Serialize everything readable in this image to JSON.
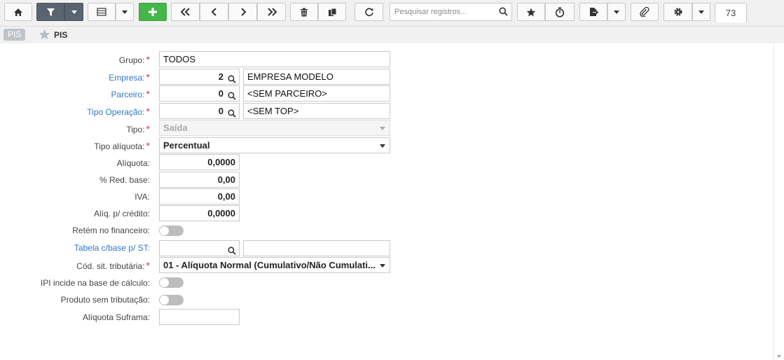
{
  "toolbar": {
    "buttons": [
      "home-icon",
      "filter-icon",
      "dropdown-caret-icon",
      "grid-icon",
      "dropdown-caret-icon",
      "plus-icon",
      "first-icon",
      "previous-icon",
      "next-icon",
      "last-icon",
      "trash-icon",
      "copy-icon",
      "refresh-icon",
      "star-icon",
      "timer-icon",
      "export-icon",
      "dropdown-caret-icon",
      "paperclip-icon",
      "gear-icon",
      "dropdown-caret-icon"
    ],
    "search_placeholder": "Pesquisar registros...",
    "record_count": "73"
  },
  "breadcrumb": {
    "tag": "PIS",
    "title": "PIS"
  },
  "form": {
    "grupo": {
      "label": "Grupo:",
      "value": "TODOS"
    },
    "empresa": {
      "label": "Empresa:",
      "code": "2",
      "name": "EMPRESA MODELO"
    },
    "parceiro": {
      "label": "Parceiro:",
      "code": "0",
      "name": "<SEM PARCEIRO>"
    },
    "tipo_operacao": {
      "label": "Tipo Operação:",
      "code": "0",
      "name": "<SEM TOP>"
    },
    "tipo": {
      "label": "Tipo:",
      "value": "Saída"
    },
    "tipo_aliquota": {
      "label": "Tipo alíquota:",
      "value": "Percentual"
    },
    "aliquota": {
      "label": "Alíquota:",
      "value": "0,0000"
    },
    "red_base": {
      "label": "% Red. base:",
      "value": "0,00"
    },
    "iva": {
      "label": "IVA:",
      "value": "0,00"
    },
    "aliq_credito": {
      "label": "Alíq. p/ crédito:",
      "value": "0,0000"
    },
    "retem_financeiro": {
      "label": "Retém no financeiro:",
      "on": false
    },
    "tabela_base_st": {
      "label": "Tabela c/base p/ ST:",
      "code": "",
      "name": ""
    },
    "cod_sit_tributaria": {
      "label": "Cód. sit. tributária:",
      "value": "01 - Alíquota Normal (Cumulativo/Não Cumulati..."
    },
    "ipi_incide": {
      "label": "IPI incide na base de cálculo:",
      "on": false
    },
    "produto_sem_tributacao": {
      "label": "Produto sem tributação:",
      "on": false
    },
    "aliquota_suframa": {
      "label": "Alíquota Suframa:",
      "value": ""
    },
    "required_mark": "*"
  },
  "colors": {
    "accent_link": "#2f77c5",
    "required": "#d9363e",
    "add_button": "#45b649",
    "filter_button": "#5a6470"
  }
}
